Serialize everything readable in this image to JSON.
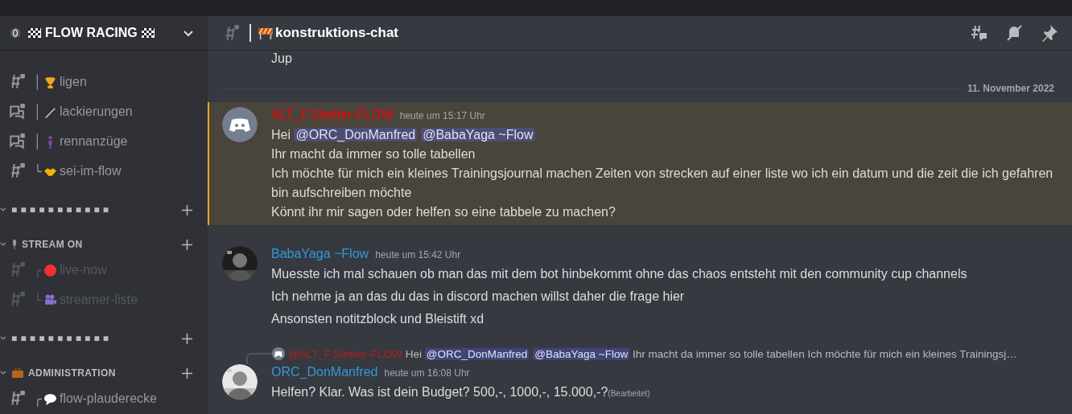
{
  "server": {
    "name": "FLOW RACING"
  },
  "sidebar": {
    "items": [
      {
        "kind": "text",
        "prefix": "│",
        "name": "ligen",
        "muted": false
      },
      {
        "kind": "forum",
        "prefix": "│",
        "name": "lackierungen",
        "muted": false
      },
      {
        "kind": "forum",
        "prefix": "│",
        "name": "rennanzüge",
        "muted": false
      },
      {
        "kind": "text",
        "prefix": "╰",
        "name": "sei-im-flow",
        "muted": false
      },
      {
        "kind": "category",
        "label": "■ ■ ■ ■ ■ ■ ■ ■ ■ ■ ■"
      },
      {
        "kind": "category",
        "label": "STREAM ON"
      },
      {
        "kind": "text",
        "prefix": "╭",
        "name": "live-now",
        "muted": true
      },
      {
        "kind": "text",
        "prefix": "╰",
        "name": "streamer-liste",
        "muted": true
      },
      {
        "kind": "category",
        "label": "■ ■ ■ ■ ■ ■ ■ ■ ■ ■ ■"
      },
      {
        "kind": "category",
        "label": "ADMINISTRATION"
      },
      {
        "kind": "text",
        "prefix": "╭",
        "name": "flow-plauderecke",
        "muted": false
      }
    ]
  },
  "channel": {
    "name": "konstruktions-chat"
  },
  "messages": [
    {
      "kind": "continuation",
      "text": "Jup"
    },
    {
      "kind": "divider",
      "text": "11. November 2022"
    },
    {
      "kind": "message",
      "author": "ALT_F.Stettler-FLOW",
      "color": "#ff0000",
      "time": "heute um 15:17 Uhr",
      "avatar": {
        "kind": "icon"
      },
      "mentioned": true,
      "lines": [
        [
          {
            "kind": "text",
            "text": "Hei "
          },
          {
            "kind": "mention",
            "text": "@ORC_DonManfred"
          },
          {
            "kind": "mention",
            "text": "@BabaYaga ~Flow"
          }
        ],
        [
          {
            "kind": "text",
            "text": "Ihr macht da immer so tolle tabellen"
          }
        ],
        [
          {
            "kind": "text",
            "text": "Ich möchte für mich ein kleines Trainingsjournal machen Zeiten von strecken auf einer liste wo ich ein datum und die zeit die ich gefahren bin aufschreiben möchte"
          }
        ],
        [
          {
            "kind": "text",
            "text": "Könnt ihr mir sagen oder helfen so eine tabbele zu machen?"
          }
        ]
      ]
    },
    {
      "kind": "group",
      "author": "BabaYaga ~Flow",
      "color": "#3498db",
      "time": "heute um 15:42 Uhr",
      "avatar": {
        "kind": "picture"
      },
      "mentioned": false,
      "lines": [
        [
          {
            "kind": "text",
            "text": "Muesste ich mal schauen ob man das mit dem bot hinbekommt ohne das chaos entsteht mit den community cup channels"
          }
        ],
        [
          {
            "kind": "text",
            "text": "Ich nehme ja an das du das in discord machen willst daher die frage hier"
          }
        ],
        [
          {
            "kind": "text",
            "text": "Ansonsten notitzblock und Bleistift xd"
          }
        ]
      ]
    },
    {
      "kind": "message",
      "author": "ORC_DonManfred",
      "color": "#3498db",
      "time": "heute um 16:08 Uhr",
      "avatar": {
        "kind": "picture"
      },
      "mentioned": false,
      "reply": {
        "author": "@ALT_F.Stettler-FLOW",
        "color": "#b81c1c",
        "parts": [
          {
            "kind": "text",
            "text": "Hei "
          },
          {
            "kind": "mention",
            "text": "@ORC_DonManfred"
          },
          {
            "kind": "mention",
            "text": "@BabaYaga ~Flow"
          },
          {
            "kind": "text",
            "text": " Ihr macht da immer so tolle tabellen Ich möchte für mich ein kleines Trainingsj…"
          }
        ]
      },
      "lines": [
        [
          {
            "kind": "text",
            "text": "Helfen? Klar. Was ist dein Budget? 500,-, 1000,-, 15.000,-?"
          }
        ]
      ],
      "edited": "(Bearbeitet)"
    }
  ]
}
